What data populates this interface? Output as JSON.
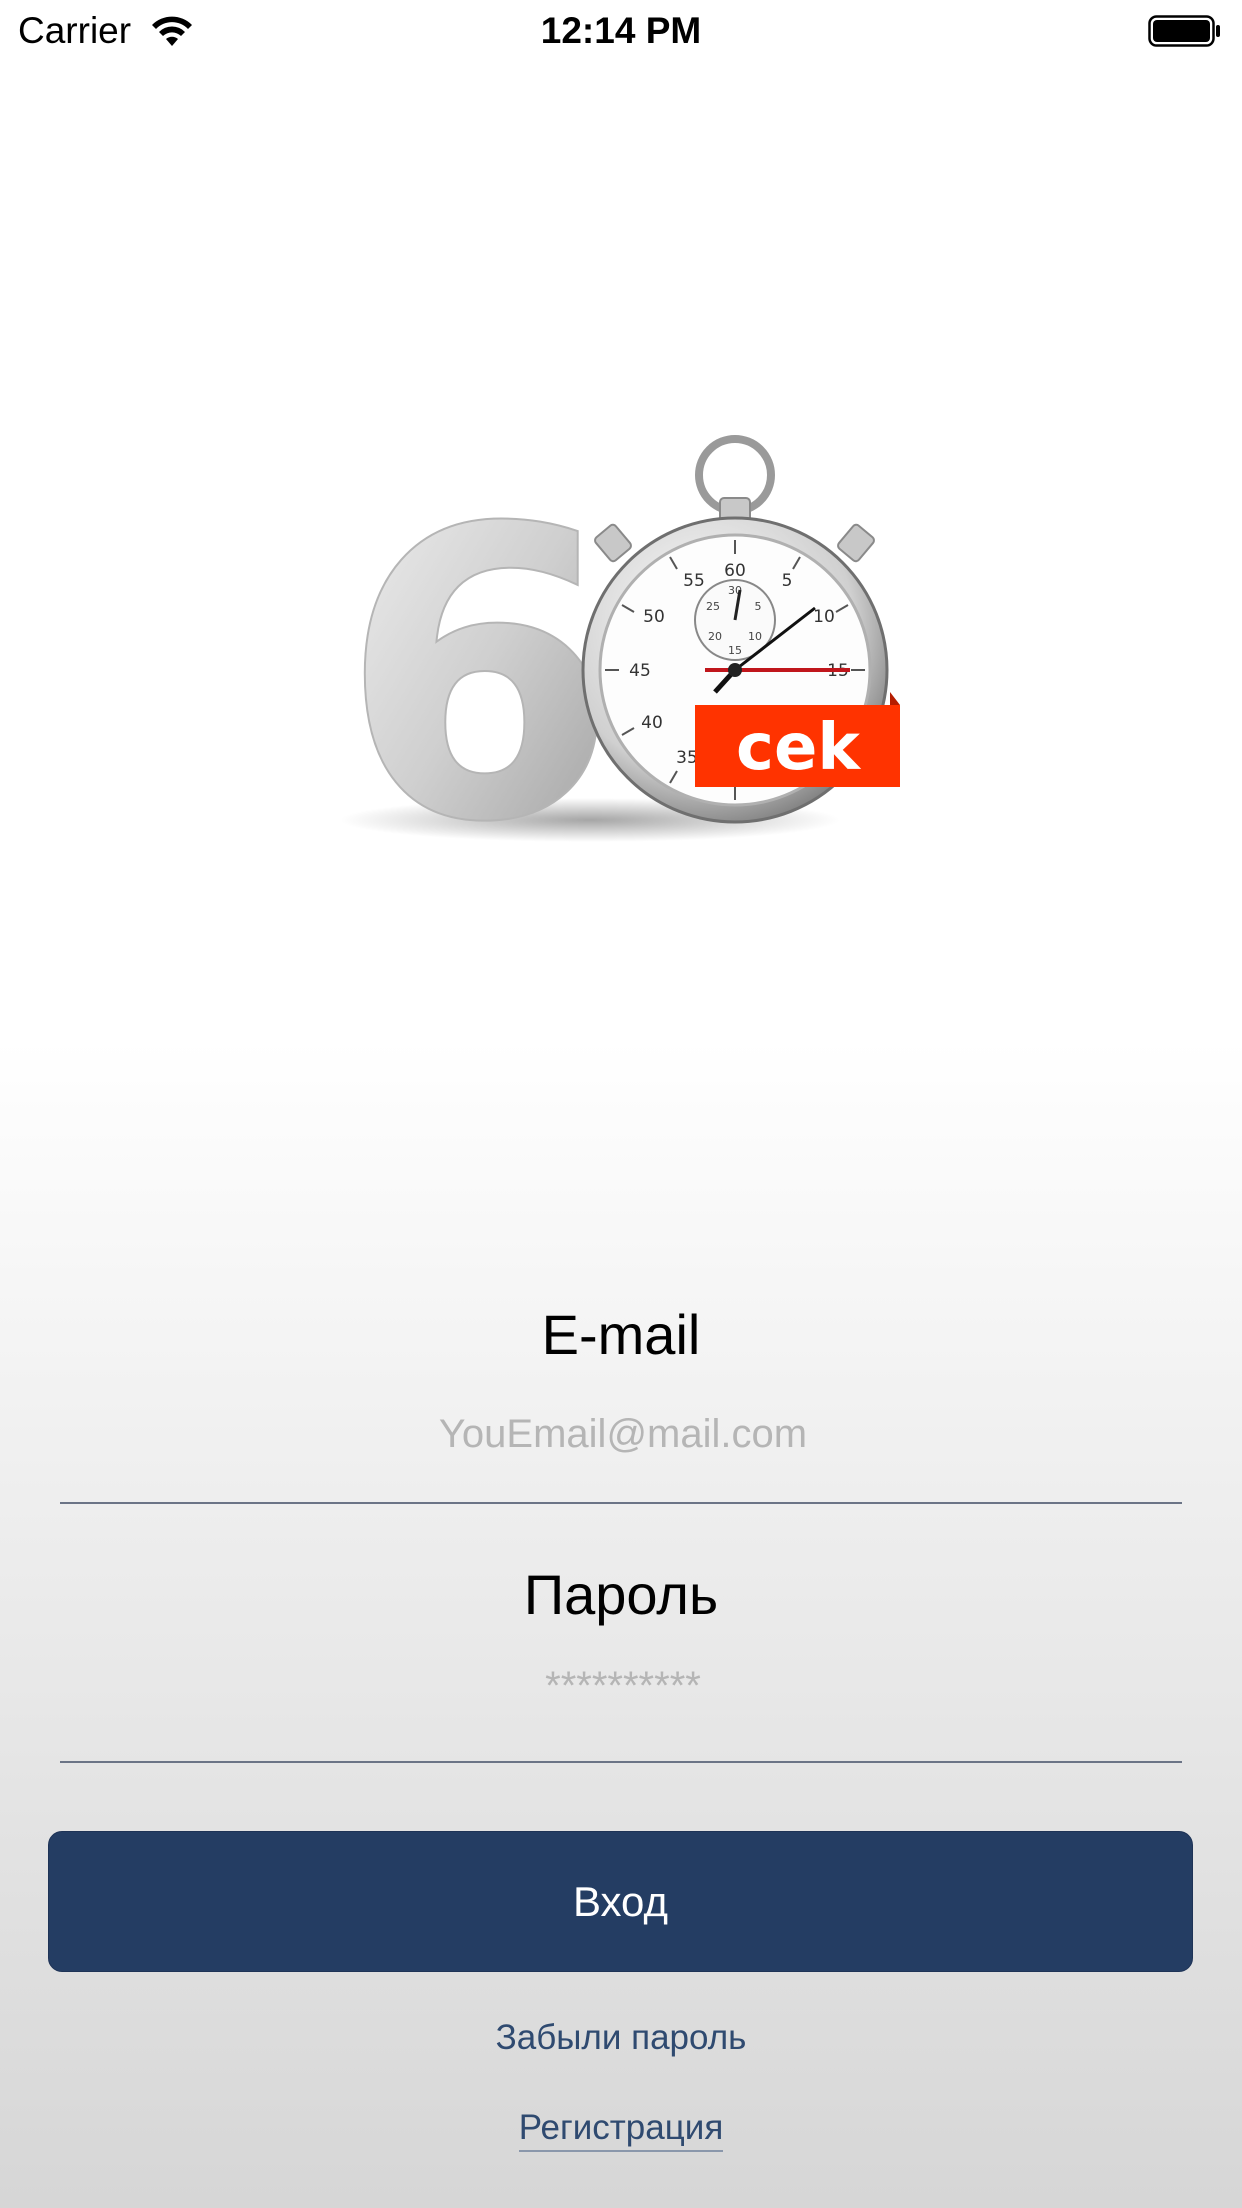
{
  "status_bar": {
    "carrier": "Carrier",
    "time": "12:14 PM",
    "wifi_icon": "wifi-icon",
    "battery_icon": "battery-icon"
  },
  "logo": {
    "icon": "stopwatch-60-sec-logo",
    "number_text": "6",
    "badge_text": "cek",
    "accent_color": "#ff3300"
  },
  "form": {
    "email_label": "E-mail",
    "email_placeholder": "YouEmail@mail.com",
    "email_value": "",
    "password_label": "Пароль",
    "password_placeholder": "**********",
    "password_value": ""
  },
  "actions": {
    "login_label": "Вход",
    "forgot_label": "Забыли пароль",
    "register_label": "Регистрация"
  },
  "colors": {
    "primary": "#243d63",
    "link": "#2f4a70"
  }
}
